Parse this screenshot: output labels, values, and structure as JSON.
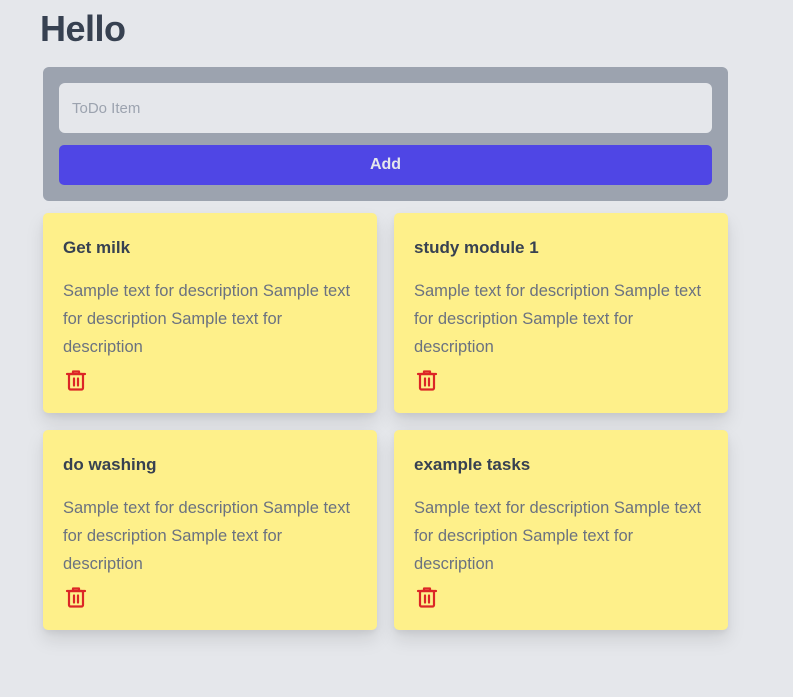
{
  "header": {
    "title": "Hello"
  },
  "add_form": {
    "input_value": "",
    "input_placeholder": "ToDo Item",
    "add_label": "Add"
  },
  "colors": {
    "page_background": "#e5e7eb",
    "panel_background": "#9ca3af",
    "button_accent": "#4f46e5",
    "card_background": "#fef08a",
    "delete_icon": "#dc2626"
  },
  "todos": [
    {
      "title": "Get milk",
      "description": "Sample text for description Sample text for description Sample text for description",
      "delete_icon": "trash-icon"
    },
    {
      "title": "study module 1",
      "description": "Sample text for description Sample text for description Sample text for description",
      "delete_icon": "trash-icon"
    },
    {
      "title": "do washing",
      "description": "Sample text for description Sample text for description Sample text for description",
      "delete_icon": "trash-icon"
    },
    {
      "title": "example tasks",
      "description": "Sample text for description Sample text for description Sample text for description",
      "delete_icon": "trash-icon"
    }
  ]
}
